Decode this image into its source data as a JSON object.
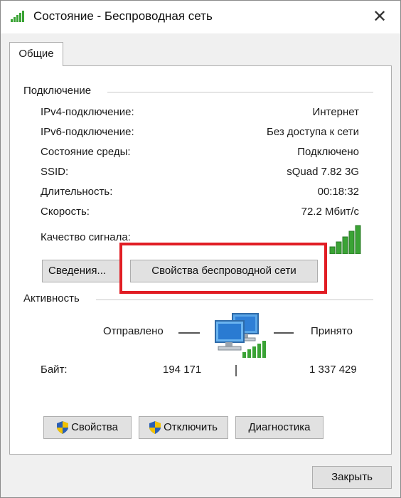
{
  "window": {
    "title": "Состояние - Беспроводная сеть",
    "close_glyph": "✕"
  },
  "tabs": [
    {
      "label": "Общие",
      "selected": true
    }
  ],
  "connection": {
    "group_title": "Подключение",
    "rows": [
      {
        "label": "IPv4-подключение:",
        "value": "Интернет"
      },
      {
        "label": "IPv6-подключение:",
        "value": "Без доступа к сети"
      },
      {
        "label": "Состояние среды:",
        "value": "Подключено"
      },
      {
        "label": "SSID:",
        "value": "sQuad 7.82 3G"
      },
      {
        "label": "Длительность:",
        "value": "00:18:32"
      },
      {
        "label": "Скорость:",
        "value": "72.2 Мбит/с"
      }
    ],
    "signal_label": "Качество сигнала:",
    "signal_bars_filled": 5,
    "signal_bars_total": 5,
    "details_button": "Сведения...",
    "wireless_properties_button": "Свойства беспроводной сети"
  },
  "activity": {
    "group_title": "Активность",
    "sent_label": "Отправлено",
    "received_label": "Принято",
    "bytes_label": "Байт:",
    "bytes_sent": "194 171",
    "bytes_received": "1 337 429"
  },
  "action_buttons": {
    "properties": "Свойства",
    "disconnect": "Отключить",
    "diagnostics": "Диагностика"
  },
  "footer": {
    "close_button": "Закрыть"
  },
  "colors": {
    "highlight": "#e11d24",
    "signal_green": "#3aa335",
    "shield_blue": "#2a5fb5",
    "shield_yellow": "#f2c200"
  },
  "icons": [
    "wifi-signal-icon",
    "close-icon",
    "network-computers-icon",
    "signal-strength-icon",
    "shield-icon"
  ]
}
